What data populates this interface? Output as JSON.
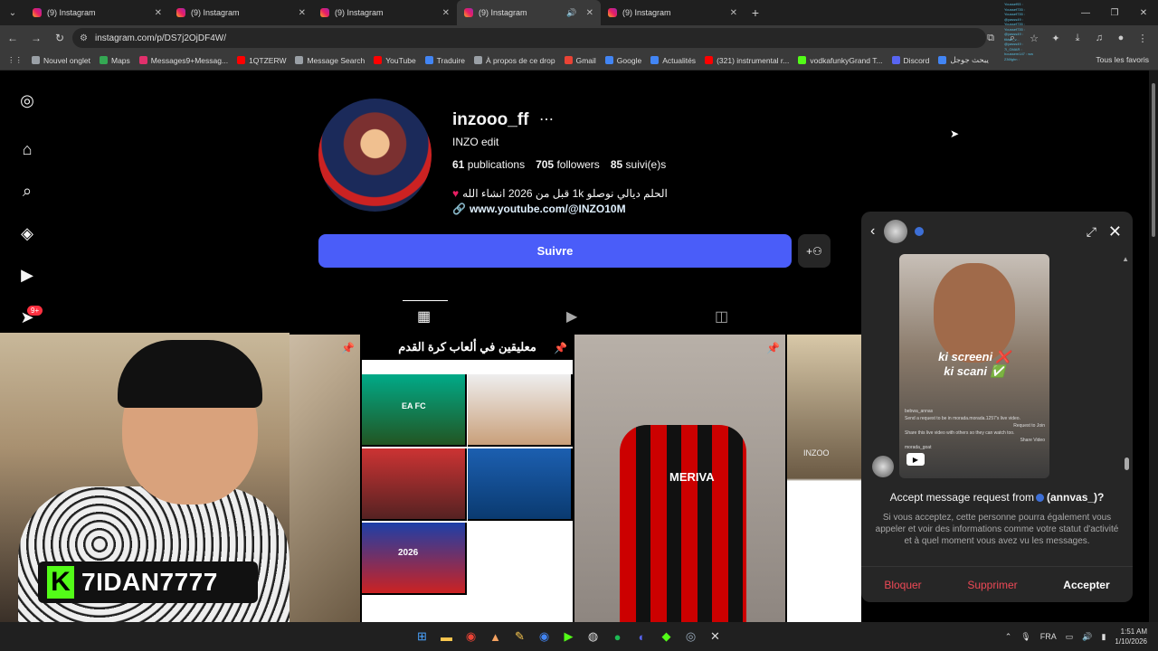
{
  "browser": {
    "tabs": [
      {
        "title": "(9) Instagram",
        "active": false
      },
      {
        "title": "(9) Instagram",
        "active": false
      },
      {
        "title": "(9) Instagram",
        "active": false
      },
      {
        "title": "(9) Instagram",
        "active": true
      },
      {
        "title": "(9) Instagram",
        "active": false
      }
    ],
    "url": "instagram.com/p/DS7j2OjDF4W/",
    "bookmarks": [
      "Nouvel onglet",
      "Maps",
      "Messages9+Messag...",
      "1QTZERW",
      "Message Search",
      "YouTube",
      "Traduire",
      "À propos de ce drop",
      "Gmail",
      "Google",
      "Actualités",
      "(321) instrumental r...",
      "vodkafunkyGrand T...",
      "Discord",
      "يبحث جوجل"
    ],
    "bookmarks_all": "Tous les favoris"
  },
  "profile": {
    "username": "inzooo_ff",
    "full_name": "INZO edit",
    "posts_count": "61",
    "posts_label": "publications",
    "followers_count": "705",
    "followers_label": "followers",
    "following_count": "85",
    "following_label": "suivi(e)s",
    "bio": "الحلم ديالي نوصلو 1k قبل من 2026 انشاء الله",
    "link": "www.youtube.com/@INZO10M",
    "follow_label": "Suivre",
    "notif_badge": "9+"
  },
  "grid": {
    "post2_title": "معليقين في ألعاب كرة القدم",
    "post2_tiles": [
      "EA FC",
      "",
      "",
      "",
      "2026",
      ""
    ],
    "post3_text": "MERIVA",
    "post4_text": "INZOO"
  },
  "stream_overlay": {
    "streamer_name": "7IDAN7777",
    "kick_letter": "K"
  },
  "dm_panel": {
    "media_caption_1": "ki screeni ❌",
    "media_caption_2": "ki scani ✅",
    "media_lines": [
      "bebwa_annas",
      "Send a request to be in morada.morada.1257's live video.",
      "Request to Join",
      "Share this live video with others so they can watch too.",
      "Share Video",
      "morada_goat"
    ],
    "request_prefix": "Accept message request from",
    "request_name": "(annvas_)?",
    "description": "Si vous acceptez, cette personne pourra également vous appeler et voir des informations comme votre statut d'activité et à quel moment vous avez vu les messages.",
    "block_label": "Bloquer",
    "delete_label": "Supprimer",
    "accept_label": "Accepter"
  },
  "chat_overlay": [
    "Youssef93 :",
    "Youssef735 :",
    "Youssef735 :",
    "@yasss49 :",
    "Youssef735 :",
    "Youssef735 :",
    "@yasss49 :",
    "tiktok_v...",
    "@yasss49 :",
    "7l_GMAR :",
    "houssem147 : ww",
    "236fghn : "
  ],
  "taskbar": {
    "lang": "FRA",
    "time": "1:51 AM",
    "date": "1/10/2026"
  },
  "colors": {
    "follow_button": "#4a5df9",
    "badge": "#ff3040",
    "danger": "#ed4956",
    "kick_green": "#53fc18"
  }
}
